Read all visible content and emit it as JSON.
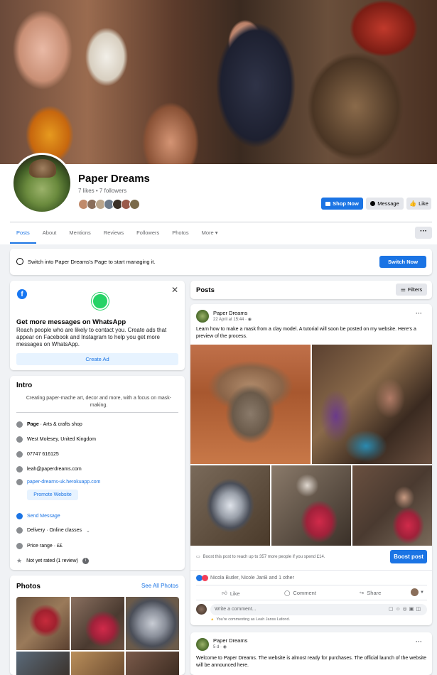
{
  "page": {
    "name": "Paper Dreams",
    "stats": "7 likes • 7 followers"
  },
  "actions": {
    "shop_now": "Shop Now",
    "message": "Message",
    "like": "Like"
  },
  "tabs": [
    {
      "label": "Posts",
      "active": true
    },
    {
      "label": "About"
    },
    {
      "label": "Mentions"
    },
    {
      "label": "Reviews"
    },
    {
      "label": "Followers"
    },
    {
      "label": "Photos"
    },
    {
      "label": "More ▾"
    }
  ],
  "more_button": "···",
  "switch_banner": {
    "text": "Switch into Paper Dreams's Page to start managing it.",
    "button": "Switch Now"
  },
  "whatsapp": {
    "title": "Get more messages on WhatsApp",
    "body": "Reach people who are likely to contact you. Create ads that appear on Facebook and Instagram to help you get more messages on WhatsApp.",
    "button": "Create Ad"
  },
  "intro": {
    "title": "Intro",
    "bio": "Creating paper-mache art, decor and more, with a focus on mask-making.",
    "category_bold": "Page",
    "category_rest": " · Arts & crafts shop",
    "location": "West Molesey, United Kingdom",
    "phone": "07747 616125",
    "email": "leah@paperdreams.com",
    "website": "paper-dreams-uk.herokuapp.com",
    "promote": "Promote Website",
    "send_message": "Send Message",
    "delivery": "Delivery · Online classes",
    "price": "Price range · ££",
    "rating": "Not yet rated (1 review)"
  },
  "photos_card": {
    "title": "Photos",
    "see_all": "See All Photos"
  },
  "posts_header": {
    "title": "Posts",
    "filters": "Filters"
  },
  "post1": {
    "author": "Paper Dreams",
    "time": "22 April at 15:44 · ",
    "text": "Learn how to make a mask from a clay model.  A tutorial will soon be posted on my website. Here's a preview of the process.",
    "boost_text": "Boost this post to reach up to 357 more people if you spend £14.",
    "boost_button": "Boost post",
    "reactions": "Nicola Butler, Nicole JanB and 1 other",
    "like": "Like",
    "comment": "Comment",
    "share": "Share",
    "comment_placeholder": "Write a comment...",
    "commenting_as": "You're commenting as Leah Janss Lafond."
  },
  "post2": {
    "author": "Paper Dreams",
    "time": "5 d · ",
    "text": "Welcome to Paper Dreams. The website is almost ready for purchases. The official launch of the website will be announced here."
  },
  "colors": {
    "accent": "#1b74e4",
    "background": "#f0f2f5",
    "muted_text": "#65676b",
    "whatsapp_green": "#25d366",
    "boost_blue": "#1b74e4"
  }
}
